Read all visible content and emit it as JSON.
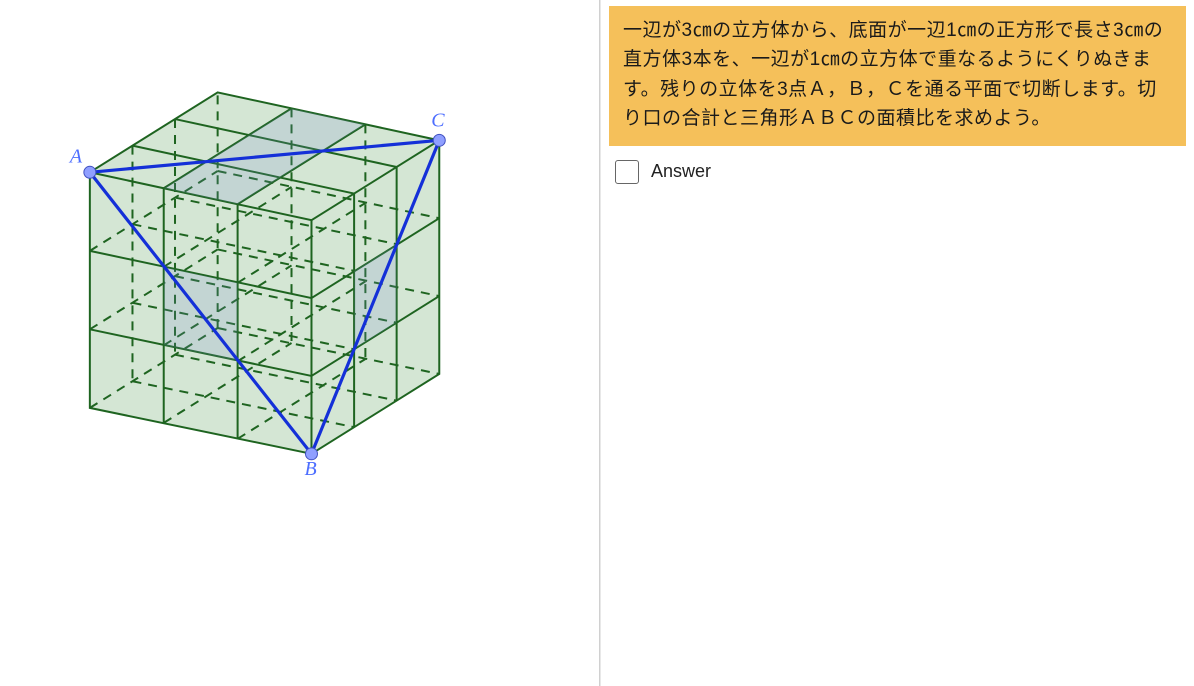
{
  "problem": {
    "text": "一辺が3㎝の立方体から、底面が一辺1㎝の正方形で長さ3㎝の直方体3本を、一辺が1㎝の立方体で重なるようにくりぬきます。残りの立体を3点Ａ，Ｂ，Ｃを通る平面で切断します。切り口の合計と三角形ＡＢＣの面積比を求めよう。"
  },
  "answer_control": {
    "label": "Answer"
  },
  "points": {
    "A": "A",
    "B": "B",
    "C": "C"
  },
  "cube": {
    "edge_cm": 3,
    "unit_cm": 1,
    "tunnels": 3,
    "triangle_vertices": [
      "A",
      "B",
      "C"
    ]
  }
}
